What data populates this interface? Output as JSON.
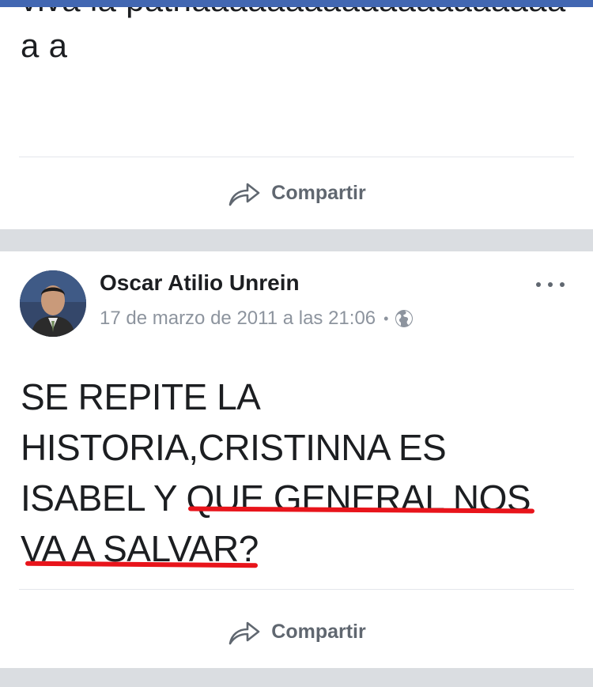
{
  "colors": {
    "brand_bar": "#4267b2",
    "underline": "#e8141b",
    "muted": "#8d949e"
  },
  "post1": {
    "text": "viva la patriaaaaaaaaaaaaaaaaaaaaa a",
    "share_label": "Compartir",
    "share_icon": "share-arrow-icon"
  },
  "post2": {
    "author": "Oscar Atilio Unrein",
    "timestamp": "17 de marzo de 2011 a las 21:06",
    "separator": "•",
    "privacy_icon": "globe-icon",
    "more_icon": "more-options-icon",
    "text_lines": [
      "SE REPITE LA",
      "HISTORIA,CRISTINNA ES",
      "ISABEL Y QUE GENERAL NOS",
      "VA A SALVAR?"
    ],
    "share_label": "Compartir",
    "share_icon": "share-arrow-icon"
  }
}
